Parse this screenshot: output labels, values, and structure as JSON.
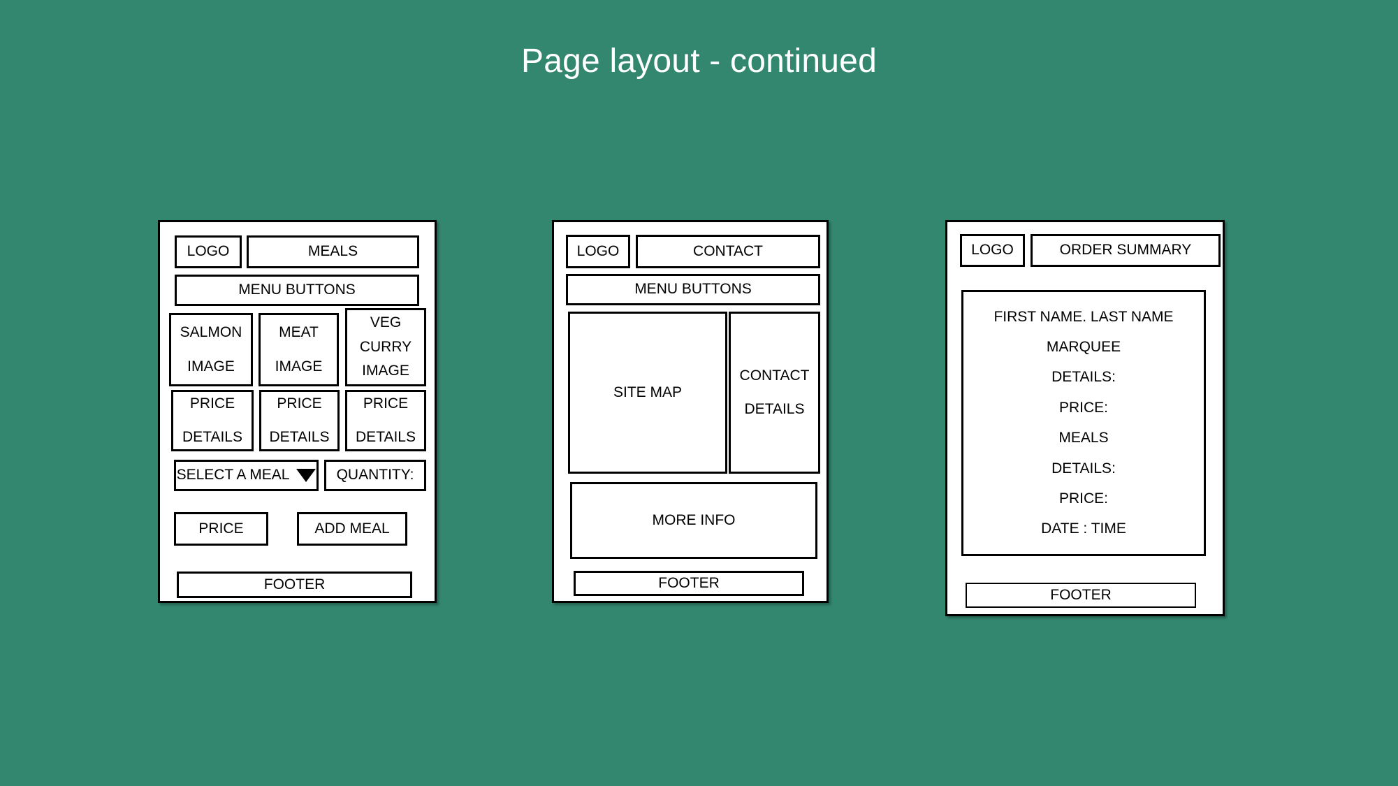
{
  "slide": {
    "title": "Page layout - continued",
    "background_color": "#33876F",
    "title_color": "#FFFFFF",
    "wireframe_fill": "#FFFFFF",
    "wireframe_stroke": "#000000"
  },
  "panels": [
    {
      "id": "meals-page",
      "name": "Meals page wireframe",
      "logo": "LOGO",
      "page_title": "MEALS",
      "menu_buttons": "MENU BUTTONS",
      "products": [
        {
          "image_label_lines": [
            "SALMON",
            "IMAGE"
          ],
          "price_label_lines": [
            "PRICE",
            "DETAILS"
          ]
        },
        {
          "image_label_lines": [
            "MEAT",
            "IMAGE"
          ],
          "price_label_lines": [
            "PRICE",
            "DETAILS"
          ]
        },
        {
          "image_label_lines": [
            "VEG",
            "CURRY",
            "IMAGE"
          ],
          "price_label_lines": [
            "PRICE",
            "DETAILS"
          ]
        }
      ],
      "select_meal": "SELECT A MEAL",
      "select_meal_icon": "dropdown-caret-icon",
      "quantity": "QUANTITY:",
      "price_button": "PRICE",
      "add_meal_button": "ADD MEAL",
      "footer": "FOOTER"
    },
    {
      "id": "contact-page",
      "name": "Contact page wireframe",
      "logo": "LOGO",
      "page_title": "CONTACT",
      "menu_buttons": "MENU BUTTONS",
      "site_map": "SITE MAP",
      "contact_details_lines": [
        "CONTACT",
        "DETAILS"
      ],
      "more_info": "MORE INFO",
      "footer": "FOOTER"
    },
    {
      "id": "order-summary-page",
      "name": "Order summary page wireframe",
      "logo": "LOGO",
      "page_title": "ORDER SUMMARY",
      "summary_lines": [
        "FIRST NAME. LAST NAME",
        "MARQUEE",
        "DETAILS:",
        "PRICE:",
        "MEALS",
        "DETAILS:",
        "PRICE:",
        "DATE : TIME"
      ],
      "footer": "FOOTER"
    }
  ]
}
